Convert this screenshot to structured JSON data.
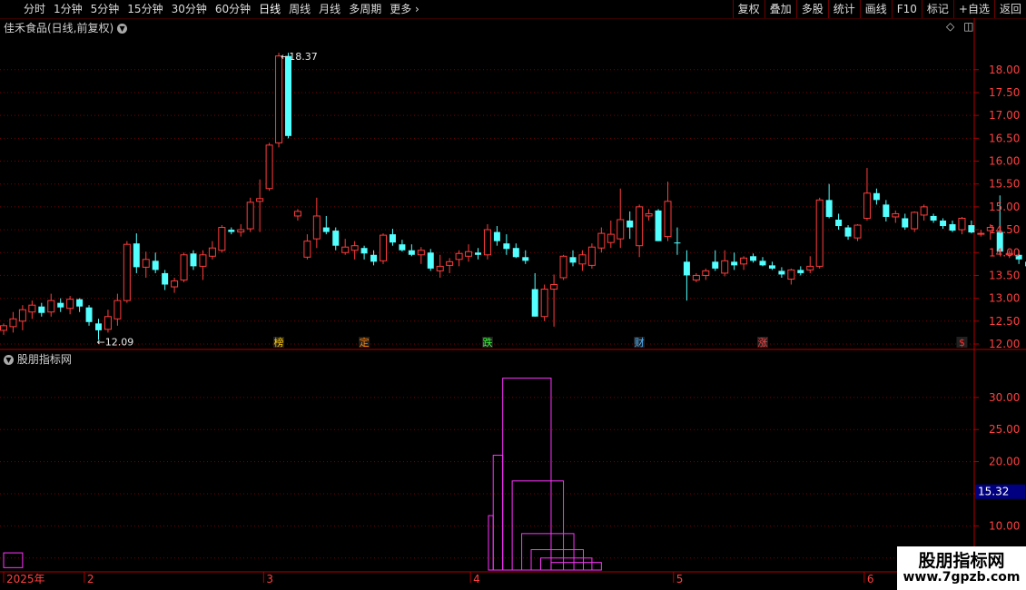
{
  "toolbar": {
    "periods": [
      "分时",
      "1分钟",
      "5分钟",
      "15分钟",
      "30分钟",
      "60分钟",
      "日线",
      "周线",
      "月线",
      "多周期",
      "更多"
    ],
    "active_period": "日线",
    "right_buttons": [
      "复权",
      "叠加",
      "多股",
      "统计",
      "画线",
      "F10",
      "标记",
      "+自选",
      "返回"
    ]
  },
  "main_panel": {
    "title": "佳禾食品(日线,前复权)"
  },
  "indicator_panel": {
    "title": "股朋指标网"
  },
  "watermark": {
    "title": "股朋指标网",
    "url": "www.7gpzb.com"
  },
  "colors": {
    "up": "#ff3c3c",
    "down": "#54ffff",
    "box": "#ff33ff",
    "axis": "#b00000",
    "grid": "#7a0000"
  },
  "chart_data": {
    "type": "candlestick",
    "price_ticks": [
      "18.00",
      "17.50",
      "17.00",
      "16.50",
      "16.00",
      "15.50",
      "15.00",
      "14.50",
      "14.00",
      "13.50",
      "13.00",
      "12.50",
      "12.00"
    ],
    "price_range": [
      11.98,
      18.73
    ],
    "ohlc": [
      [
        12.3,
        12.45,
        12.2,
        12.4
      ],
      [
        12.38,
        12.7,
        12.25,
        12.55
      ],
      [
        12.5,
        12.85,
        12.3,
        12.75
      ],
      [
        12.7,
        12.95,
        12.55,
        12.85
      ],
      [
        12.82,
        12.9,
        12.6,
        12.68
      ],
      [
        12.7,
        13.1,
        12.6,
        12.95
      ],
      [
        12.9,
        13.0,
        12.7,
        12.8
      ],
      [
        12.78,
        13.05,
        12.65,
        12.98
      ],
      [
        12.98,
        13.0,
        12.7,
        12.82
      ],
      [
        12.8,
        12.85,
        12.4,
        12.48
      ],
      [
        12.45,
        12.55,
        12.09,
        12.3
      ],
      [
        12.32,
        12.75,
        12.25,
        12.6
      ],
      [
        12.55,
        13.1,
        12.4,
        12.95
      ],
      [
        12.95,
        14.25,
        12.9,
        14.18
      ],
      [
        14.2,
        14.42,
        13.55,
        13.68
      ],
      [
        13.68,
        14.02,
        13.45,
        13.85
      ],
      [
        13.82,
        14.0,
        13.55,
        13.62
      ],
      [
        13.55,
        13.62,
        13.18,
        13.3
      ],
      [
        13.25,
        13.45,
        13.12,
        13.38
      ],
      [
        13.4,
        14.0,
        13.35,
        13.95
      ],
      [
        13.98,
        14.05,
        13.62,
        13.7
      ],
      [
        13.7,
        14.05,
        13.4,
        13.95
      ],
      [
        13.92,
        14.25,
        13.85,
        14.1
      ],
      [
        14.05,
        14.6,
        14.0,
        14.55
      ],
      [
        14.5,
        14.55,
        14.4,
        14.45
      ],
      [
        14.45,
        14.62,
        14.35,
        14.5
      ],
      [
        14.52,
        15.2,
        14.45,
        15.1
      ],
      [
        15.12,
        15.6,
        14.45,
        15.18
      ],
      [
        15.4,
        16.4,
        15.35,
        16.35
      ],
      [
        16.4,
        18.37,
        16.3,
        18.3
      ],
      [
        18.3,
        18.37,
        16.5,
        16.55
      ],
      [
        14.8,
        14.95,
        14.7,
        14.9
      ],
      [
        13.9,
        14.4,
        13.85,
        14.25
      ],
      [
        14.3,
        15.2,
        14.1,
        14.8
      ],
      [
        14.55,
        14.8,
        14.4,
        14.45
      ],
      [
        14.48,
        14.55,
        14.05,
        14.15
      ],
      [
        14.0,
        14.3,
        13.95,
        14.12
      ],
      [
        14.05,
        14.25,
        13.85,
        14.15
      ],
      [
        14.1,
        14.15,
        13.85,
        13.98
      ],
      [
        13.95,
        14.05,
        13.72,
        13.8
      ],
      [
        13.82,
        14.42,
        13.75,
        14.38
      ],
      [
        14.4,
        14.52,
        14.15,
        14.22
      ],
      [
        14.18,
        14.28,
        14.02,
        14.05
      ],
      [
        14.05,
        14.18,
        13.92,
        13.95
      ],
      [
        13.95,
        14.12,
        13.75,
        14.05
      ],
      [
        14.0,
        14.08,
        13.6,
        13.65
      ],
      [
        13.6,
        13.95,
        13.45,
        13.7
      ],
      [
        13.72,
        13.88,
        13.55,
        13.8
      ],
      [
        13.85,
        14.05,
        13.7,
        13.98
      ],
      [
        13.92,
        14.18,
        13.8,
        14.02
      ],
      [
        14.0,
        14.1,
        13.85,
        13.95
      ],
      [
        13.95,
        14.62,
        13.85,
        14.5
      ],
      [
        14.45,
        14.58,
        14.15,
        14.25
      ],
      [
        14.2,
        14.4,
        13.95,
        14.08
      ],
      [
        14.1,
        14.2,
        13.88,
        13.9
      ],
      [
        13.9,
        14.05,
        13.75,
        13.82
      ],
      [
        13.2,
        13.55,
        12.6,
        12.6
      ],
      [
        12.6,
        13.3,
        12.5,
        13.2
      ],
      [
        13.2,
        13.52,
        12.38,
        13.3
      ],
      [
        13.45,
        13.95,
        13.4,
        13.92
      ],
      [
        13.9,
        14.05,
        13.7,
        13.78
      ],
      [
        13.75,
        14.05,
        13.6,
        13.95
      ],
      [
        13.72,
        14.2,
        13.65,
        14.12
      ],
      [
        14.1,
        14.55,
        14.0,
        14.42
      ],
      [
        14.22,
        14.7,
        14.1,
        14.4
      ],
      [
        14.3,
        15.4,
        14.1,
        14.72
      ],
      [
        14.7,
        14.9,
        14.3,
        14.55
      ],
      [
        14.15,
        15.05,
        13.9,
        15.0
      ],
      [
        14.8,
        14.95,
        14.7,
        14.85
      ],
      [
        14.92,
        14.95,
        14.25,
        14.25
      ],
      [
        14.35,
        15.55,
        14.25,
        15.12
      ],
      [
        14.22,
        14.55,
        13.95,
        14.2
      ],
      [
        13.8,
        14.05,
        12.95,
        13.5
      ],
      [
        13.4,
        13.55,
        13.35,
        13.5
      ],
      [
        13.5,
        13.65,
        13.4,
        13.6
      ],
      [
        13.8,
        14.05,
        13.6,
        13.65
      ],
      [
        13.55,
        14.05,
        13.48,
        13.82
      ],
      [
        13.8,
        14.0,
        13.62,
        13.72
      ],
      [
        13.75,
        13.92,
        13.62,
        13.88
      ],
      [
        13.92,
        13.98,
        13.78,
        13.82
      ],
      [
        13.82,
        13.9,
        13.7,
        13.72
      ],
      [
        13.72,
        13.8,
        13.62,
        13.65
      ],
      [
        13.6,
        13.68,
        13.45,
        13.52
      ],
      [
        13.42,
        13.65,
        13.3,
        13.62
      ],
      [
        13.62,
        13.7,
        13.5,
        13.55
      ],
      [
        13.62,
        13.92,
        13.55,
        13.7
      ],
      [
        13.7,
        15.2,
        13.65,
        15.15
      ],
      [
        15.15,
        15.5,
        14.75,
        14.78
      ],
      [
        14.72,
        14.85,
        14.5,
        14.58
      ],
      [
        14.55,
        14.6,
        14.28,
        14.35
      ],
      [
        14.32,
        14.62,
        14.25,
        14.6
      ],
      [
        14.75,
        15.85,
        14.7,
        15.3
      ],
      [
        15.3,
        15.4,
        15.05,
        15.15
      ],
      [
        15.05,
        15.15,
        14.68,
        14.78
      ],
      [
        14.78,
        14.92,
        14.65,
        14.85
      ],
      [
        14.75,
        14.85,
        14.5,
        14.55
      ],
      [
        14.52,
        14.9,
        14.45,
        14.88
      ],
      [
        14.82,
        15.05,
        14.7,
        15.0
      ],
      [
        14.8,
        14.85,
        14.65,
        14.7
      ],
      [
        14.7,
        14.75,
        14.52,
        14.58
      ],
      [
        14.62,
        14.7,
        14.45,
        14.48
      ],
      [
        14.5,
        14.78,
        14.4,
        14.75
      ],
      [
        14.6,
        14.7,
        14.42,
        14.44
      ],
      [
        14.4,
        14.5,
        14.35,
        14.42
      ],
      [
        14.48,
        14.62,
        14.28,
        14.55
      ],
      [
        14.45,
        15.25,
        13.95,
        14.02
      ],
      [
        13.95,
        14.05,
        13.88,
        13.98
      ],
      [
        13.95,
        14.05,
        13.75,
        13.85
      ],
      [
        13.8,
        13.85,
        13.65,
        13.7
      ],
      [
        13.65,
        13.72,
        13.45,
        13.55
      ],
      [
        13.55,
        13.6,
        13.38,
        13.38
      ],
      [
        13.42,
        13.6,
        13.25,
        13.58
      ],
      [
        13.62,
        13.75,
        13.55,
        13.7
      ]
    ],
    "annotations": [
      {
        "label": "18.37",
        "price": 18.37,
        "candle": 29
      },
      {
        "label": "12.09",
        "price": 12.09,
        "candle": 10
      }
    ],
    "event_markers": [
      {
        "label": "榜",
        "candle": 29,
        "color": "#ffc800"
      },
      {
        "label": "定",
        "candle": 38,
        "color": "#ff7f00"
      },
      {
        "label": "跌",
        "candle": 51,
        "color": "#33ff33"
      },
      {
        "label": "财",
        "candle": 67,
        "color": "#50b4ff"
      },
      {
        "label": "涨",
        "candle": 80,
        "color": "#ff4444"
      },
      {
        "label": "$",
        "candle": 101,
        "color": "#ff3030"
      }
    ],
    "indicator": {
      "ticks": [
        "30.00",
        "25.00",
        "20.00",
        "15.00",
        "10.00",
        "5.00"
      ],
      "range": [
        3.55,
        34.64
      ],
      "current_value": "15.32",
      "boxes": [
        [
          51.1,
          51.6,
          1,
          11.6
        ],
        [
          51.6,
          52.6,
          1,
          21.0
        ],
        [
          52.6,
          57.7,
          1,
          33.0
        ],
        [
          53.6,
          59.0,
          1,
          17.0
        ],
        [
          54.6,
          60.1,
          1,
          8.8
        ],
        [
          55.6,
          61.1,
          1,
          6.3
        ],
        [
          56.6,
          62.0,
          1,
          5.0
        ],
        [
          57.7,
          63.0,
          1,
          4.3
        ],
        [
          0,
          2.0,
          3.5,
          5.8
        ]
      ]
    },
    "x_labels": [
      {
        "label": "2025年",
        "candle": 0
      },
      {
        "label": "2",
        "candle": 8.5
      },
      {
        "label": "3",
        "candle": 27.4
      },
      {
        "label": "4",
        "candle": 49.2
      },
      {
        "label": "5",
        "candle": 70.6
      },
      {
        "label": "6",
        "candle": 90.7
      }
    ]
  }
}
